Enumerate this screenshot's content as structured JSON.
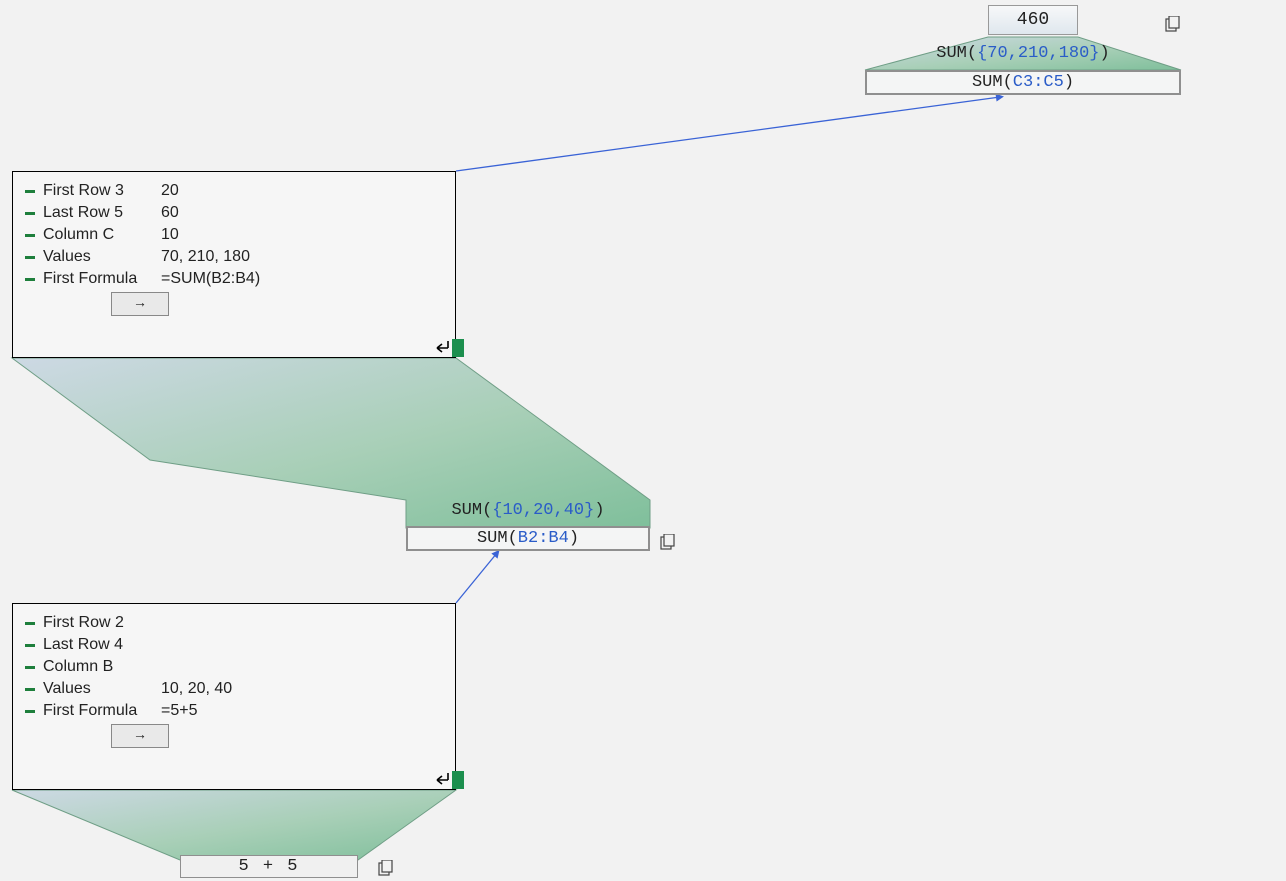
{
  "top": {
    "result": "460",
    "eval_fn": "SUM(",
    "eval_array": "{70,210,180}",
    "eval_close": ")",
    "formula_fn": "SUM(",
    "formula_ref": "C3:C5",
    "formula_close": ")"
  },
  "panel1": {
    "rows": [
      {
        "label": "First Row 3",
        "value": "20"
      },
      {
        "label": "Last Row 5",
        "value": "60"
      },
      {
        "label": "Column C",
        "value": "10"
      },
      {
        "label": "Values",
        "value": "70, 210, 180"
      },
      {
        "label": "First Formula",
        "value": "=SUM(B2:B4)"
      }
    ],
    "arrow": "→"
  },
  "mid": {
    "eval_fn": "SUM(",
    "eval_array": "{10,20,40}",
    "eval_close": ")",
    "formula_fn": "SUM(",
    "formula_ref": "B2:B4",
    "formula_close": ")"
  },
  "panel2": {
    "rows": [
      {
        "label": "First Row 2",
        "value": ""
      },
      {
        "label": "Last Row 4",
        "value": ""
      },
      {
        "label": "Column B",
        "value": ""
      },
      {
        "label": "Values",
        "value": "10, 20, 40"
      },
      {
        "label": "First Formula",
        "value": "=5+5"
      }
    ],
    "arrow": "→"
  },
  "bottom": {
    "expr": "5   +   5"
  }
}
